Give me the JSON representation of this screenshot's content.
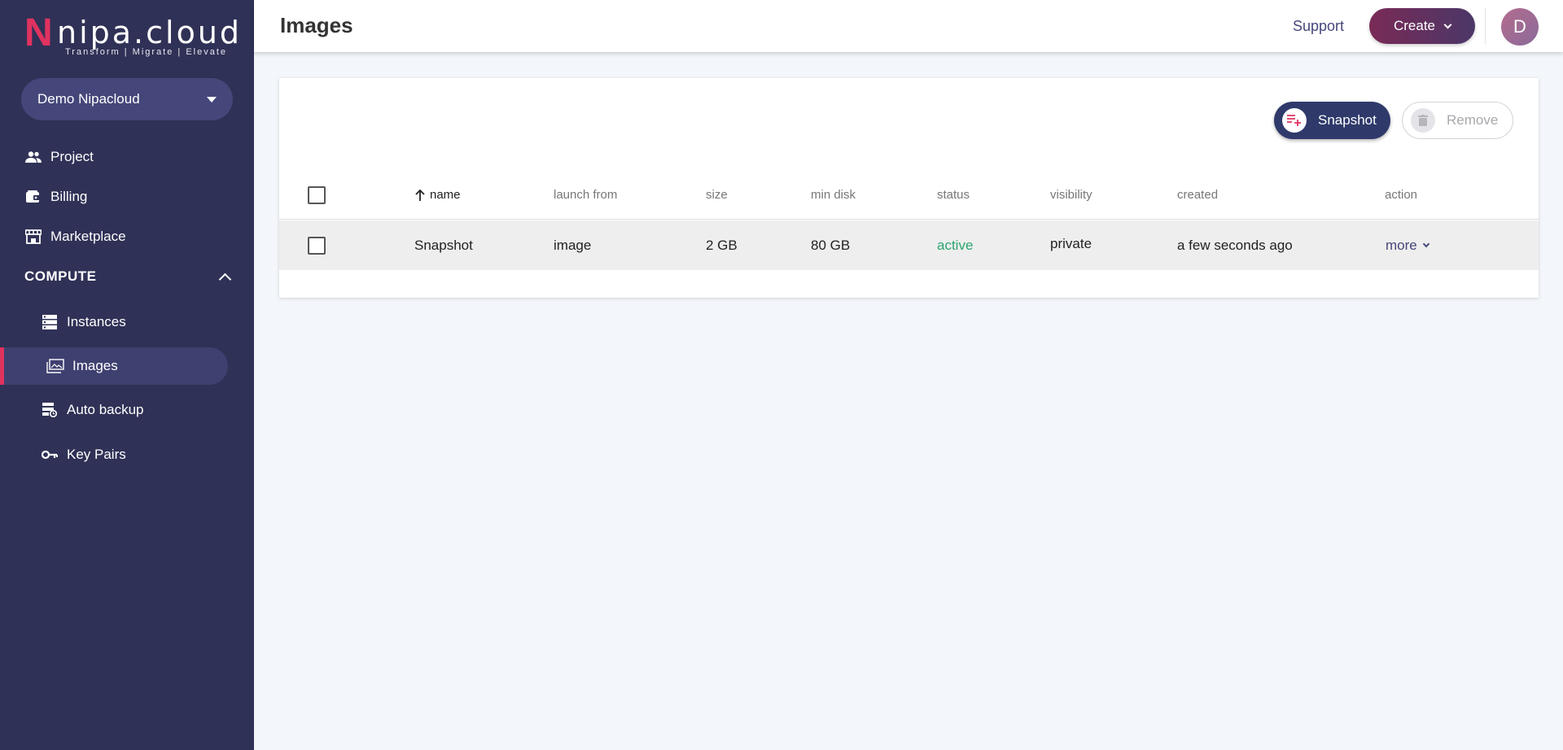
{
  "brand": {
    "logo_letter": "N",
    "logo_word": "nipa.cloud",
    "tagline": "Transform  |  Migrate  |  Elevate",
    "accent": "#e0325f",
    "sidebar_bg": "#2f3156"
  },
  "sidebar": {
    "org_selector": {
      "value": "Demo Nipacloud"
    },
    "top_items": [
      {
        "label": "Project",
        "icon": "people-icon"
      },
      {
        "label": "Billing",
        "icon": "wallet-icon"
      },
      {
        "label": "Marketplace",
        "icon": "store-icon"
      }
    ],
    "section": {
      "label": "COMPUTE",
      "expanded": true
    },
    "compute_items": [
      {
        "label": "Instances",
        "icon": "server-icon",
        "active": false
      },
      {
        "label": "Images",
        "icon": "images-icon",
        "active": true
      },
      {
        "label": "Auto backup",
        "icon": "backup-icon",
        "active": false
      },
      {
        "label": "Key Pairs",
        "icon": "key-icon",
        "active": false
      }
    ]
  },
  "header": {
    "title": "Images",
    "support_label": "Support",
    "create_label": "Create",
    "avatar_initial": "D"
  },
  "toolbar": {
    "snapshot_label": "Snapshot",
    "remove_label": "Remove",
    "remove_disabled": true
  },
  "table": {
    "columns": [
      "name",
      "launch from",
      "size",
      "min disk",
      "status",
      "visibility",
      "created",
      "action"
    ],
    "sort": {
      "column": "name",
      "direction": "ascending"
    },
    "rows": [
      {
        "name": "Snapshot",
        "launch_from": "image",
        "size": "2 GB",
        "min_disk": "80 GB",
        "status": "active",
        "visibility": "private",
        "created": "a few seconds ago",
        "action": "more"
      }
    ]
  },
  "colors": {
    "status_active": "#2aa56f",
    "primary_button": "#2f3a6b",
    "create_gradient_start": "#7a2a56",
    "create_gradient_end": "#4b3768"
  }
}
